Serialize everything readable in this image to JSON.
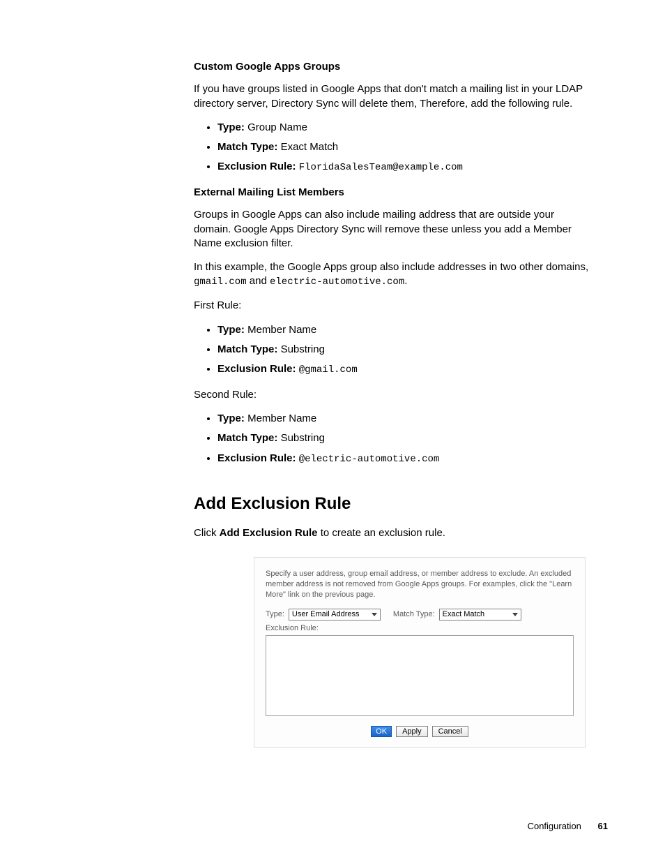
{
  "section1": {
    "heading": "Custom Google Apps Groups",
    "p1": "If you have groups listed in Google Apps that don't match a mailing list in your LDAP directory server, Directory Sync will delete them, Therefore, add the following rule.",
    "list": [
      {
        "label": "Type:",
        "value": " Group Name"
      },
      {
        "label": "Match Type:",
        "value": " Exact Match"
      },
      {
        "label": "Exclusion Rule:",
        "code": "FloridaSalesTeam@example.com"
      }
    ]
  },
  "section2": {
    "heading": "External Mailing List Members",
    "p1": "Groups in Google Apps can also include mailing address that are outside your domain. Google Apps Directory Sync will remove these unless you add a Member Name exclusion filter.",
    "p2_pre": "In this example, the Google Apps group also include addresses in two other domains, ",
    "p2_code1": "gmail.com",
    "p2_mid": " and ",
    "p2_code2": "electric-automotive.com",
    "p2_post": ".",
    "first_rule_label": "First Rule:",
    "first_rule": [
      {
        "label": "Type:",
        "value": " Member Name"
      },
      {
        "label": "Match Type:",
        "value": " Substring"
      },
      {
        "label": "Exclusion Rule:",
        "code": "@gmail.com"
      }
    ],
    "second_rule_label": "Second Rule:",
    "second_rule": [
      {
        "label": "Type:",
        "value": " Member Name"
      },
      {
        "label": "Match Type:",
        "value": " Substring"
      },
      {
        "label": "Exclusion Rule:",
        "code": "@electric-automotive.com"
      }
    ]
  },
  "section3": {
    "title": "Add Exclusion Rule",
    "intro_pre": "Click ",
    "intro_bold": "Add Exclusion Rule",
    "intro_post": " to create an exclusion rule."
  },
  "dialog": {
    "description": "Specify a user address, group email address, or member address to exclude. An excluded member address is not removed from Google Apps groups. For examples, click the \"Learn More\" link on the previous page.",
    "type_label": "Type:",
    "type_value": "User Email Address",
    "match_label": "Match Type:",
    "match_value": "Exact Match",
    "rule_label": "Exclusion Rule:",
    "buttons": {
      "ok": "OK",
      "apply": "Apply",
      "cancel": "Cancel"
    }
  },
  "footer": {
    "label": "Configuration",
    "page": "61"
  }
}
